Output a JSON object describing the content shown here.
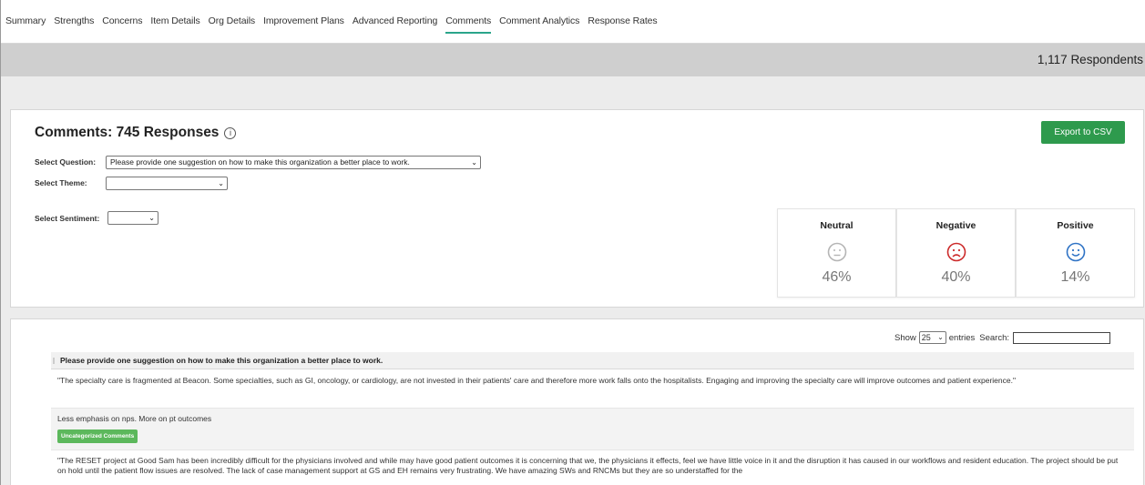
{
  "nav": {
    "tabs": [
      {
        "label": "Summary"
      },
      {
        "label": "Strengths"
      },
      {
        "label": "Concerns"
      },
      {
        "label": "Item Details"
      },
      {
        "label": "Org Details"
      },
      {
        "label": "Improvement Plans"
      },
      {
        "label": "Advanced Reporting"
      },
      {
        "label": "Comments"
      },
      {
        "label": "Comment Analytics"
      },
      {
        "label": "Response Rates"
      }
    ],
    "active": "Comments"
  },
  "banner": {
    "respondents": "1,117 Respondents"
  },
  "comments_panel": {
    "title": "Comments: 745 Responses",
    "info_icon": "info-icon",
    "export_label": "Export to CSV",
    "select_question_label": "Select Question:",
    "select_question_value": "Please provide one suggestion on how to make this organization a better place to work.",
    "select_theme_label": "Select Theme:",
    "select_theme_value": "",
    "select_sentiment_label": "Select Sentiment:",
    "select_sentiment_value": ""
  },
  "sentiment_cards": [
    {
      "label": "Neutral",
      "percent": "46%",
      "icon": "neutral-face-icon",
      "color": "#b5b5b5"
    },
    {
      "label": "Negative",
      "percent": "40%",
      "icon": "sad-face-icon",
      "color": "#cc2a2a"
    },
    {
      "label": "Positive",
      "percent": "14%",
      "icon": "happy-face-icon",
      "color": "#2f73c5"
    }
  ],
  "table": {
    "show_label": "Show",
    "entries_value": "25",
    "entries_label": "entries",
    "search_label": "Search:",
    "search_value": "",
    "column_header": "Please provide one suggestion on how to make this organization a better place to work.",
    "rows": [
      {
        "text": "\"The specialty care is fragmented at Beacon. Some specialties, such as GI, oncology, or cardiology, are not invested in their patients' care and therefore more work falls onto the hospitalists. Engaging and improving the specialty care will improve outcomes and patient experience.\"",
        "tag": ""
      },
      {
        "text": "Less emphasis on nps. More on pt outcomes",
        "tag": "Uncategorized Comments"
      },
      {
        "text": "\"The RESET project at Good Sam has been incredibly difficult for the physicians involved and while may have good patient outcomes it is concerning that we, the physicians it effects, feel we have little voice in it and the disruption it has caused in our workflows and resident education. The project should be put on hold until the patient flow issues are resolved. The lack of case management support at GS and EH remains very frustrating. We have amazing SWs and RNCMs but they are so understaffed for the",
        "tag": ""
      }
    ]
  },
  "colors": {
    "active_tab_underline": "#2aa58a",
    "export_button": "#2e9a4d",
    "tag": "#5cb85c",
    "banner": "#cfcfcf"
  }
}
